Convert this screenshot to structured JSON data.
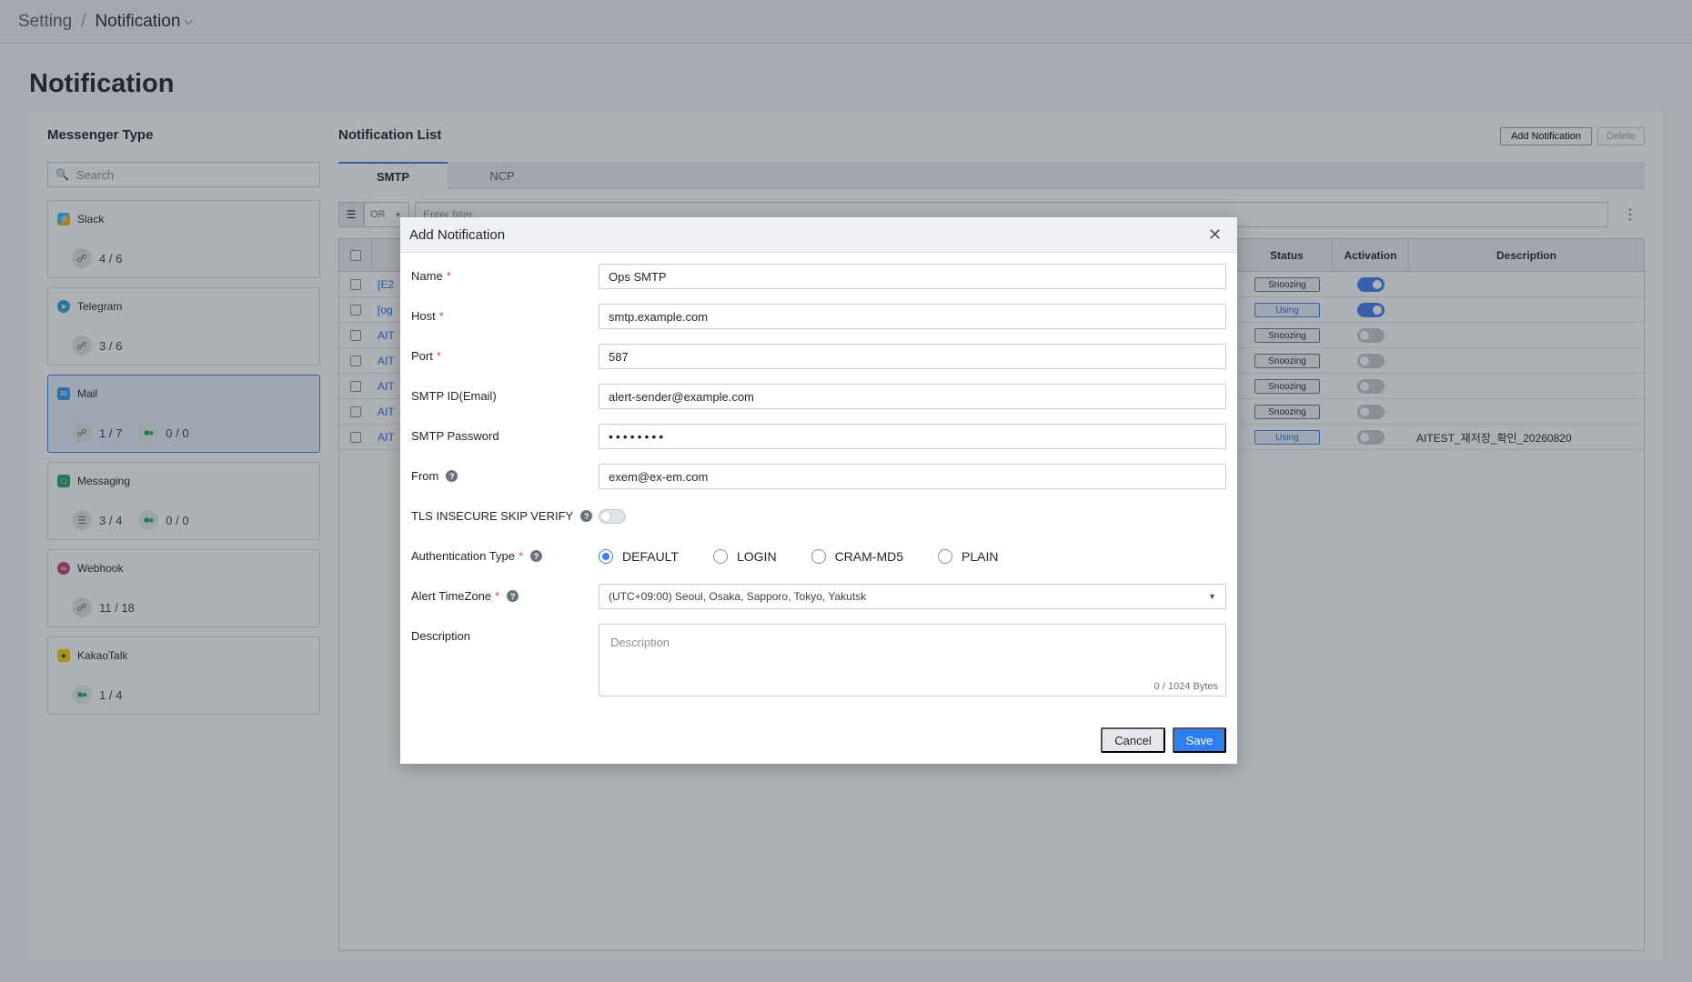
{
  "breadcrumb": {
    "root": "Setting",
    "separator": "/",
    "current": "Notification"
  },
  "page": {
    "title": "Notification"
  },
  "sidebar": {
    "title": "Messenger Type",
    "search_placeholder": "Search",
    "items": [
      {
        "name": "Slack",
        "icon": "slack-icon",
        "stats": [
          {
            "icon": "link-icon",
            "value": "4 / 6"
          }
        ]
      },
      {
        "name": "Telegram",
        "icon": "telegram-icon",
        "stats": [
          {
            "icon": "link-icon",
            "value": "3 / 6"
          }
        ]
      },
      {
        "name": "Mail",
        "icon": "mail-icon",
        "active": true,
        "stats": [
          {
            "icon": "link-icon",
            "value": "1 / 7"
          },
          {
            "icon": "green-toggle-icon",
            "value": "0 / 0"
          }
        ]
      },
      {
        "name": "Messaging",
        "icon": "messaging-icon",
        "stats": [
          {
            "icon": "database-icon",
            "value": "3 / 4"
          },
          {
            "icon": "green-toggle-icon",
            "value": "0 / 0"
          }
        ]
      },
      {
        "name": "Webhook",
        "icon": "webhook-icon",
        "stats": [
          {
            "icon": "link-icon",
            "value": "11 / 18"
          }
        ]
      },
      {
        "name": "KakaoTalk",
        "icon": "kakaotalk-icon",
        "stats": [
          {
            "icon": "green-toggle-icon",
            "value": "1 / 4"
          }
        ]
      }
    ]
  },
  "main": {
    "title": "Notification List",
    "add_button": "Add Notification",
    "delete_button": "Delete",
    "tabs": [
      {
        "label": "SMTP",
        "active": true
      },
      {
        "label": "NCP",
        "active": false
      }
    ],
    "filter": {
      "operator": "OR",
      "placeholder": "Enter filter."
    },
    "columns": {
      "status": "Status",
      "activation": "Activation",
      "description": "Description"
    },
    "rows": [
      {
        "name": "[E2",
        "status": "Snoozing",
        "active": true,
        "description": ""
      },
      {
        "name": "[og",
        "status": "Using",
        "active": true,
        "description": ""
      },
      {
        "name": "AIT",
        "status": "Snoozing",
        "active": false,
        "description": ""
      },
      {
        "name": "AIT",
        "status": "Snoozing",
        "active": false,
        "description": ""
      },
      {
        "name": "AIT",
        "status": "Snoozing",
        "active": false,
        "description": ""
      },
      {
        "name": "AIT",
        "status": "Snoozing",
        "active": false,
        "description": ""
      },
      {
        "name": "AIT",
        "status": "Using",
        "active": false,
        "description": "AITEST_재저장_확인_20260820"
      }
    ]
  },
  "modal": {
    "title": "Add Notification",
    "fields": {
      "name": {
        "label": "Name",
        "value": "Ops SMTP"
      },
      "host": {
        "label": "Host",
        "value": "smtp.example.com"
      },
      "port": {
        "label": "Port",
        "value": "587"
      },
      "smtp_id": {
        "label": "SMTP ID(Email)",
        "value": "alert-sender@example.com"
      },
      "smtp_password": {
        "label": "SMTP Password",
        "value": "••••••••"
      },
      "from": {
        "label": "From",
        "value": "exem@ex-em.com"
      },
      "tls": {
        "label": "TLS INSECURE SKIP VERIFY",
        "enabled": false
      },
      "auth_type": {
        "label": "Authentication Type",
        "options": [
          "DEFAULT",
          "LOGIN",
          "CRAM-MD5",
          "PLAIN"
        ],
        "selected": "DEFAULT"
      },
      "timezone": {
        "label": "Alert TimeZone",
        "value": "(UTC+09:00) Seoul, Osaka, Sapporo, Tokyo, Yakutsk"
      },
      "description": {
        "label": "Description",
        "placeholder": "Description",
        "counter": "0 / 1024 Bytes"
      }
    },
    "cancel_label": "Cancel",
    "save_label": "Save"
  },
  "colors": {
    "accent": "#2f7ef0",
    "required": "#e03e3e",
    "success": "#1fa363"
  }
}
